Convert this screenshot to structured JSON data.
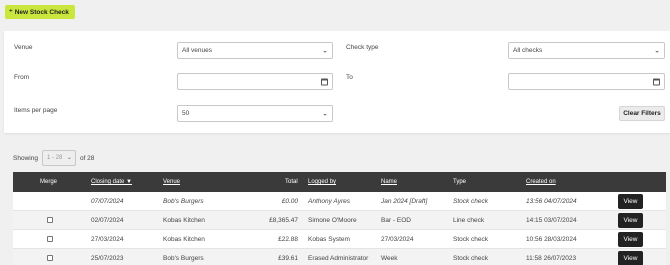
{
  "toolbar": {
    "new_label": "New Stock Check"
  },
  "filters": {
    "venue_label": "Venue",
    "venue_value": "All venues",
    "check_type_label": "Check type",
    "check_type_value": "All checks",
    "from_label": "From",
    "to_label": "To",
    "per_page_label": "Items per page",
    "per_page_value": "50",
    "clear_label": "Clear Filters"
  },
  "pagination": {
    "showing_label": "Showing",
    "range": "1 - 28",
    "of_label": "of 28"
  },
  "table": {
    "headers": {
      "merge": "Merge",
      "closing_date": "Closing date ▼",
      "venue": "Venue",
      "total": "Total",
      "logged_by": "Logged by",
      "name": "Name",
      "type": "Type",
      "created_on": "Created on"
    },
    "rows": [
      {
        "merge": false,
        "closing_date": "07/07/2024",
        "venue": "Bob's Burgers",
        "total": "£0.00",
        "logged_by": "Anthony Ayres",
        "name": "Jan 2024 [Draft]",
        "type": "Stock check",
        "created_on": "13:56 04/07/2024",
        "action": "View"
      },
      {
        "merge": true,
        "closing_date": "02/07/2024",
        "venue": "Kobas Kitchen",
        "total": "£8,365.47",
        "logged_by": "Simone O'Moore",
        "name": "Bar - EOD",
        "type": "Line check",
        "created_on": "14:15 03/07/2024",
        "action": "View"
      },
      {
        "merge": true,
        "closing_date": "27/03/2024",
        "venue": "Kobas Kitchen",
        "total": "£22.88",
        "logged_by": "Kobas System",
        "name": "27/03/2024",
        "type": "Stock check",
        "created_on": "10:56 28/03/2024",
        "action": "View"
      },
      {
        "merge": true,
        "closing_date": "25/07/2023",
        "venue": "Bob's Burgers",
        "total": "£39.61",
        "logged_by": "Erased Administrator",
        "name": "Week",
        "type": "Stock check",
        "created_on": "11:58 26/07/2023",
        "action": "View"
      }
    ]
  }
}
